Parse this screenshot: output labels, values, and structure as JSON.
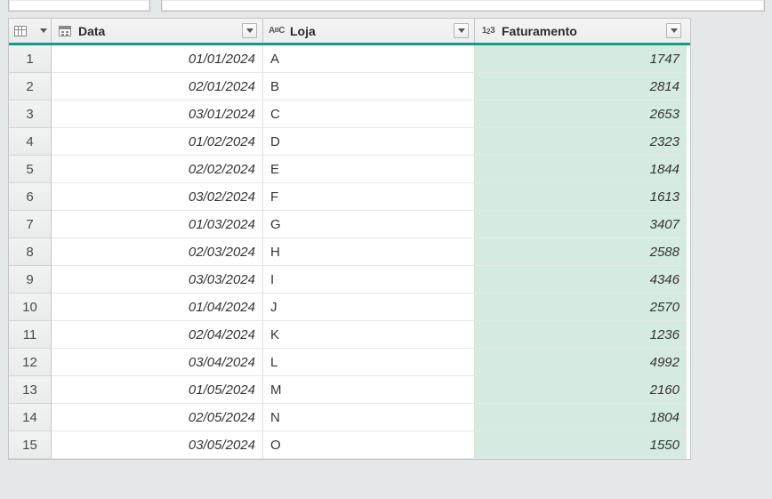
{
  "columns": {
    "data": {
      "label": "Data",
      "type": "date"
    },
    "loja": {
      "label": "Loja",
      "type": "text"
    },
    "fat": {
      "label": "Faturamento",
      "type": "number",
      "highlighted": true
    }
  },
  "rows": [
    {
      "n": "1",
      "data": "01/01/2024",
      "loja": "A",
      "fat": "1747"
    },
    {
      "n": "2",
      "data": "02/01/2024",
      "loja": "B",
      "fat": "2814"
    },
    {
      "n": "3",
      "data": "03/01/2024",
      "loja": "C",
      "fat": "2653"
    },
    {
      "n": "4",
      "data": "01/02/2024",
      "loja": "D",
      "fat": "2323"
    },
    {
      "n": "5",
      "data": "02/02/2024",
      "loja": "E",
      "fat": "1844"
    },
    {
      "n": "6",
      "data": "03/02/2024",
      "loja": "F",
      "fat": "1613"
    },
    {
      "n": "7",
      "data": "01/03/2024",
      "loja": "G",
      "fat": "3407"
    },
    {
      "n": "8",
      "data": "02/03/2024",
      "loja": "H",
      "fat": "2588"
    },
    {
      "n": "9",
      "data": "03/03/2024",
      "loja": "I",
      "fat": "4346"
    },
    {
      "n": "10",
      "data": "01/04/2024",
      "loja": "J",
      "fat": "2570"
    },
    {
      "n": "11",
      "data": "02/04/2024",
      "loja": "K",
      "fat": "1236"
    },
    {
      "n": "12",
      "data": "03/04/2024",
      "loja": "L",
      "fat": "4992"
    },
    {
      "n": "13",
      "data": "01/05/2024",
      "loja": "M",
      "fat": "2160"
    },
    {
      "n": "14",
      "data": "02/05/2024",
      "loja": "N",
      "fat": "1804"
    },
    {
      "n": "15",
      "data": "03/05/2024",
      "loja": "O",
      "fat": "1550"
    }
  ]
}
